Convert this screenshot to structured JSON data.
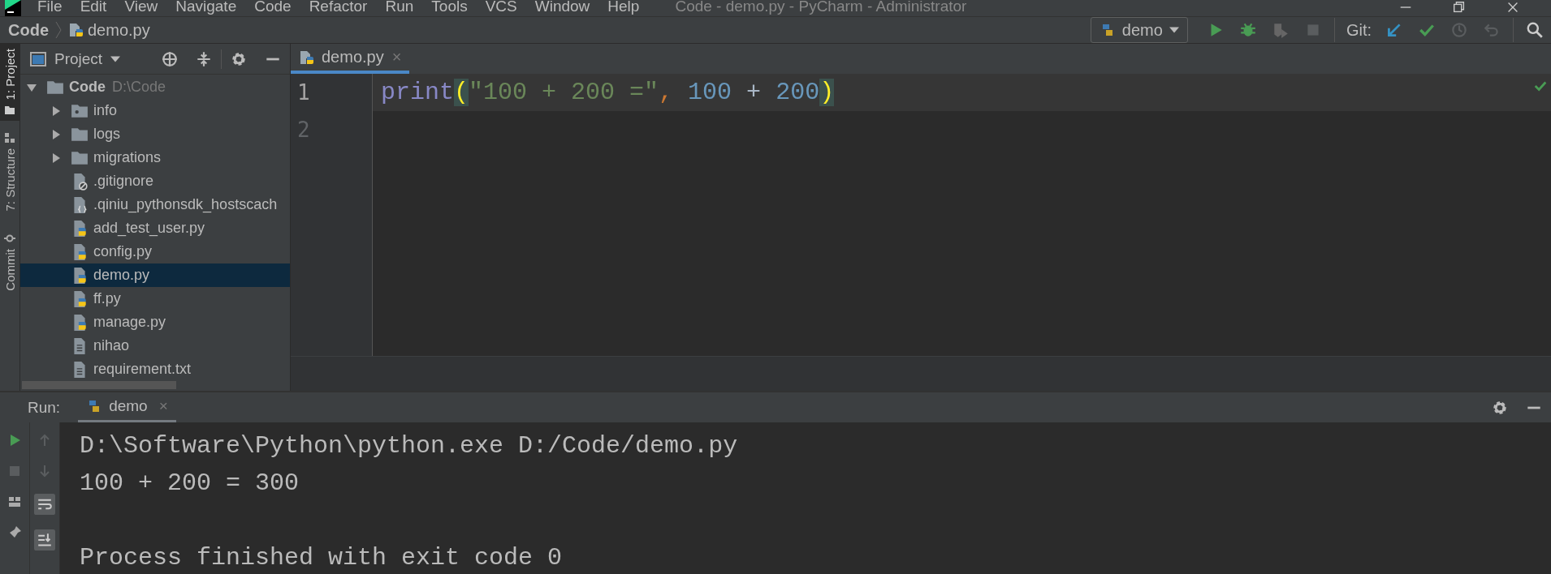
{
  "window": {
    "title": "Code - demo.py - PyCharm - Administrator"
  },
  "menu": [
    "File",
    "Edit",
    "View",
    "Navigate",
    "Code",
    "Refactor",
    "Run",
    "Tools",
    "VCS",
    "Window",
    "Help"
  ],
  "breadcrumb": [
    "Code",
    "demo.py"
  ],
  "run_config": {
    "label": "demo"
  },
  "git_label": "Git:",
  "side_tabs": [
    {
      "label": "1: Project",
      "kind": "folder",
      "selected": true
    },
    {
      "label": "7: Structure",
      "kind": "structure",
      "selected": false
    },
    {
      "label": "Commit",
      "kind": "commit",
      "selected": false
    }
  ],
  "project_panel": {
    "title": "Project"
  },
  "tree": [
    {
      "name": "Code",
      "path": "D:\\Code",
      "kind": "folder",
      "expanded": true,
      "selected": false,
      "children": [
        {
          "name": "info",
          "kind": "package",
          "expanded": false,
          "selected": false
        },
        {
          "name": "logs",
          "kind": "folder",
          "expanded": false,
          "selected": false
        },
        {
          "name": "migrations",
          "kind": "folder",
          "expanded": false,
          "selected": false
        },
        {
          "name": ".gitignore",
          "kind": "ignore",
          "selected": false
        },
        {
          "name": ".qiniu_pythonsdk_hostscach",
          "kind": "config",
          "selected": false
        },
        {
          "name": "add_test_user.py",
          "kind": "python",
          "selected": false
        },
        {
          "name": "config.py",
          "kind": "python",
          "selected": false
        },
        {
          "name": "demo.py",
          "kind": "python",
          "selected": true
        },
        {
          "name": "ff.py",
          "kind": "python",
          "selected": false
        },
        {
          "name": "manage.py",
          "kind": "python",
          "selected": false
        },
        {
          "name": "nihao",
          "kind": "text",
          "selected": false
        },
        {
          "name": "requirement.txt",
          "kind": "text",
          "selected": false
        }
      ]
    }
  ],
  "editor_tabs": [
    {
      "label": "demo.py",
      "close": "×",
      "selected": true
    }
  ],
  "editor": {
    "lines": [
      {
        "number": "1",
        "current": true,
        "tokens": [
          {
            "kind": "builtin",
            "text": "print"
          },
          {
            "kind": "bracket",
            "text": "("
          },
          {
            "kind": "string",
            "text": "\"100 + 200 =\""
          },
          {
            "kind": "punct",
            "text": ", "
          },
          {
            "kind": "number",
            "text": "100"
          },
          {
            "kind": "plain",
            "text": " + "
          },
          {
            "kind": "number",
            "text": "200"
          },
          {
            "kind": "bracket",
            "text": ")"
          }
        ]
      },
      {
        "number": "2",
        "current": false
      }
    ]
  },
  "run_panel": {
    "label": "Run:",
    "tabs": [
      {
        "label": "demo",
        "close": "×",
        "selected": true
      }
    ],
    "output": [
      "D:\\Software\\Python\\python.exe D:/Code/demo.py",
      "100 + 200 = 300"
    ],
    "exit_message": "Process finished with exit code 0"
  }
}
